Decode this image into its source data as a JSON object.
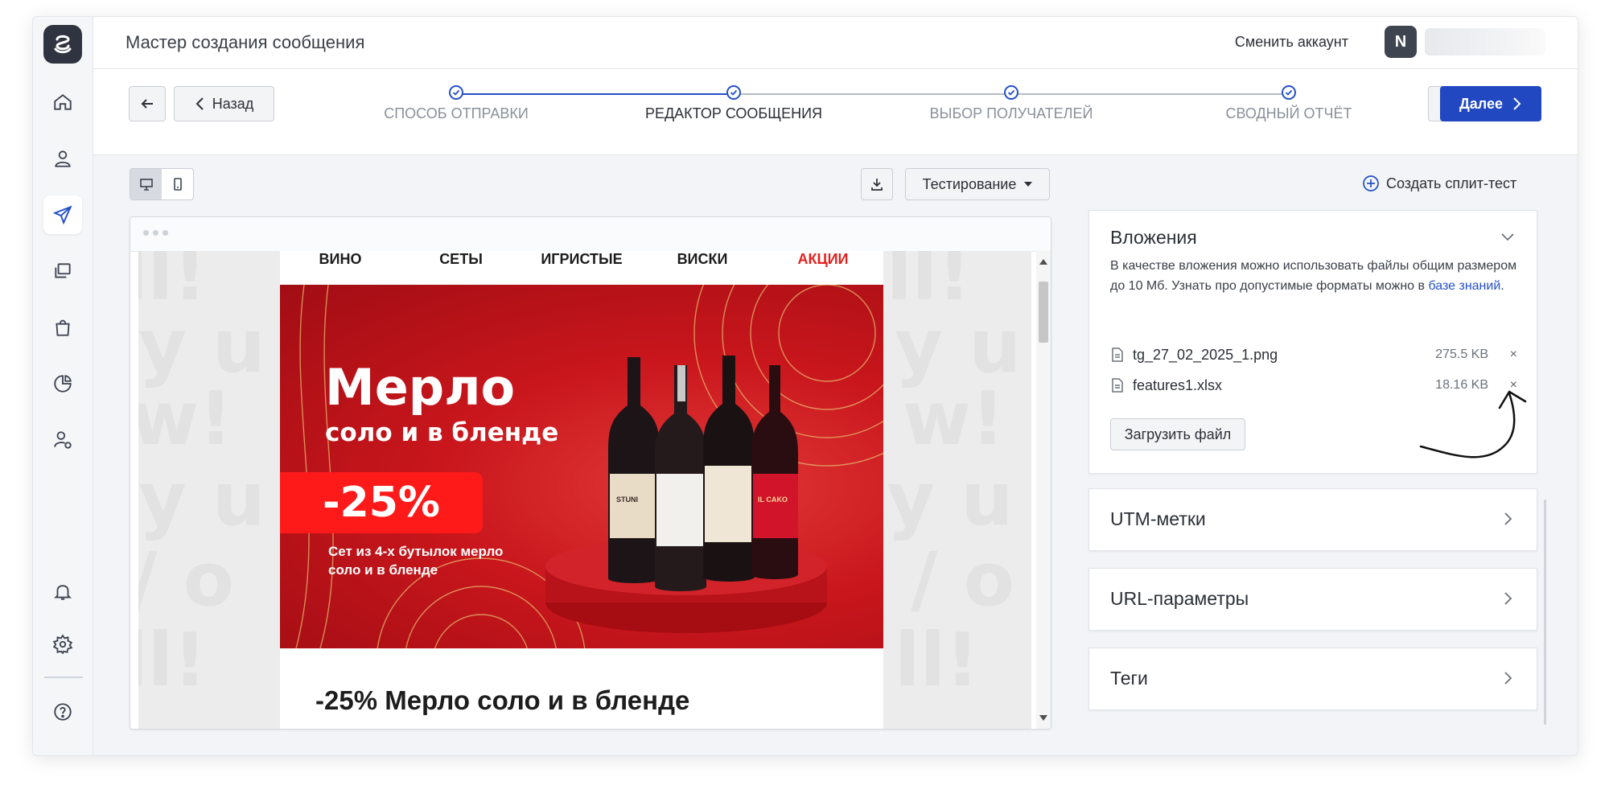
{
  "header": {
    "title": "Мастер создания сообщения",
    "switch_account": "Сменить аккаунт",
    "avatar_initial": "N"
  },
  "sidebar": {
    "items": [
      "home-icon",
      "contacts-icon",
      "send-icon",
      "templates-icon",
      "shop-icon",
      "analytics-icon",
      "user-settings-icon",
      "bell-icon",
      "gear-icon",
      "help-icon"
    ],
    "active": "send-icon"
  },
  "wizard": {
    "back_label": "Назад",
    "next_label": "Далее",
    "steps": [
      {
        "label": "СПОСОБ ОТПРАВКИ",
        "done": true
      },
      {
        "label": "РЕДАКТОР СООБЩЕНИЯ",
        "done": true,
        "current": true
      },
      {
        "label": "ВЫБОР ПОЛУЧАТЕЛЕЙ",
        "done": true
      },
      {
        "label": "СВОДНЫЙ ОТЧЁТ",
        "done": true
      }
    ]
  },
  "toolbar": {
    "testing_label": "Тестирование",
    "split_test_label": "Создать сплит-тест"
  },
  "email": {
    "menu": [
      "ВИНО",
      "СЕТЫ",
      "ИГРИСТЫЕ",
      "ВИСКИ",
      "АКЦИИ"
    ],
    "banner_title": "Мерло",
    "banner_subtitle": "соло и в бленде",
    "banner_discount": "-25%",
    "banner_note": "Сет из 4-х бутылок мерло соло и в бленде",
    "heading": "-25% Мерло соло и в бленде",
    "bottle_labels": [
      "STUNI",
      "",
      "",
      "IL CAKO"
    ]
  },
  "attachments": {
    "title": "Вложения",
    "description": "В качестве вложения можно использовать файлы общим размером до 10 Мб. Узнать про допустимые форматы можно в ",
    "link_text": "базе знаний",
    "description_end": ".",
    "files": [
      {
        "name": "tg_27_02_2025_1.png",
        "size": "275.5 KB"
      },
      {
        "name": "features1.xlsx",
        "size": "18.16 KB"
      }
    ],
    "remove_symbol": "×",
    "upload_label": "Загрузить файл"
  },
  "panels": [
    {
      "title": "UTM-метки"
    },
    {
      "title": "URL-параметры"
    },
    {
      "title": "Теги"
    }
  ],
  "colors": {
    "accent": "#2148c0",
    "banner_red": "#c8161c",
    "sale_red": "#e3211e"
  }
}
